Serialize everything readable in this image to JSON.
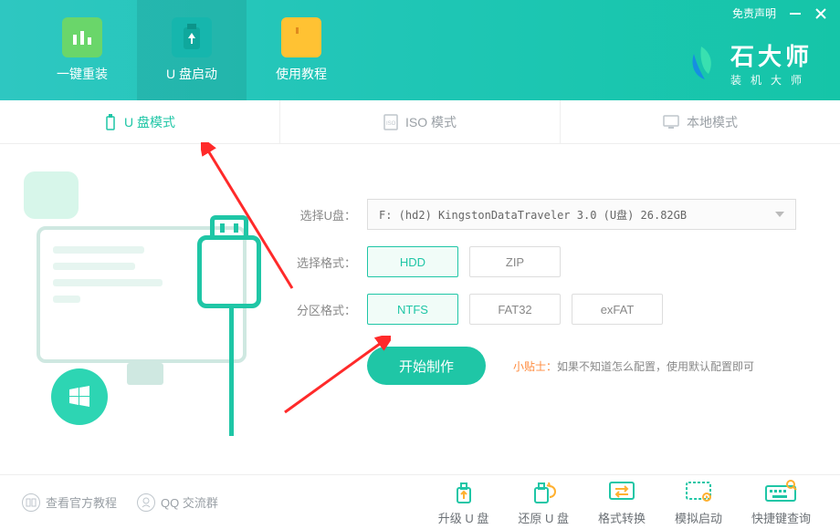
{
  "header": {
    "tabs": [
      {
        "label": "一键重装"
      },
      {
        "label": "U 盘启动"
      },
      {
        "label": "使用教程"
      }
    ],
    "disclaimer": "免责声明",
    "brand_big": "石大师",
    "brand_small": "装机大师"
  },
  "modes": {
    "items": [
      {
        "label": "U 盘模式"
      },
      {
        "label": "ISO 模式"
      },
      {
        "label": "本地模式"
      }
    ]
  },
  "form": {
    "udisk_label": "选择U盘：",
    "udisk_value": "F: (hd2) KingstonDataTraveler 3.0 (U盘) 26.82GB",
    "format_label": "选择格式：",
    "format_opts": [
      "HDD",
      "ZIP"
    ],
    "format_sel": "HDD",
    "partition_label": "分区格式：",
    "partition_opts": [
      "NTFS",
      "FAT32",
      "exFAT"
    ],
    "partition_sel": "NTFS",
    "start_btn": "开始制作",
    "tip_label": "小贴士：",
    "tip_text": "如果不知道怎么配置，使用默认配置即可"
  },
  "bottom": {
    "links": [
      {
        "label": "查看官方教程"
      },
      {
        "label": "QQ 交流群"
      }
    ],
    "actions": [
      {
        "label": "升级 U 盘"
      },
      {
        "label": "还原 U 盘"
      },
      {
        "label": "格式转换"
      },
      {
        "label": "模拟启动"
      },
      {
        "label": "快捷键查询"
      }
    ]
  }
}
